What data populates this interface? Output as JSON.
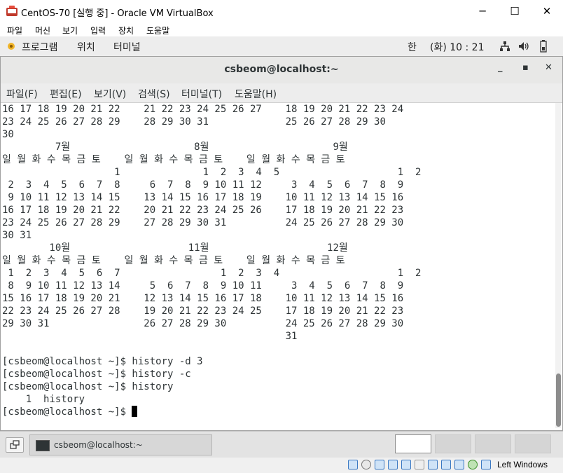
{
  "vbox": {
    "title": "CentOS-70 [실행 중] - Oracle VM VirtualBox",
    "minimize": "─",
    "maximize": "☐",
    "close": "✕",
    "menu": [
      "파일",
      "머신",
      "보기",
      "입력",
      "장치",
      "도움말"
    ]
  },
  "gnome": {
    "apps": "프로그램",
    "places": "위치",
    "terminal": "터미널",
    "input_method": "한",
    "clock": "(화) 10 : 21",
    "network_icon": "network-icon",
    "volume_icon": "volume-icon",
    "battery_icon": "battery-icon"
  },
  "terminal": {
    "title": "csbeom@localhost:~",
    "minimize": "_",
    "maximize": "▪",
    "close": "✕",
    "menu": [
      "파일(F)",
      "편집(E)",
      "보기(V)",
      "검색(S)",
      "터미널(T)",
      "도움말(H)"
    ],
    "lines": [
      "16 17 18 19 20 21 22    21 22 23 24 25 26 27    18 19 20 21 22 23 24",
      "23 24 25 26 27 28 29    28 29 30 31             25 26 27 28 29 30",
      "30",
      "         7월                     8월                     9월",
      "일 월 화 수 목 금 토    일 월 화 수 목 금 토    일 월 화 수 목 금 토",
      "                   1              1  2  3  4  5                    1  2",
      " 2  3  4  5  6  7  8     6  7  8  9 10 11 12     3  4  5  6  7  8  9",
      " 9 10 11 12 13 14 15    13 14 15 16 17 18 19    10 11 12 13 14 15 16",
      "16 17 18 19 20 21 22    20 21 22 23 24 25 26    17 18 19 20 21 22 23",
      "23 24 25 26 27 28 29    27 28 29 30 31          24 25 26 27 28 29 30",
      "30 31",
      "        10월                    11월                    12월",
      "일 월 화 수 목 금 토    일 월 화 수 목 금 토    일 월 화 수 목 금 토",
      " 1  2  3  4  5  6  7                 1  2  3  4                    1  2",
      " 8  9 10 11 12 13 14     5  6  7  8  9 10 11     3  4  5  6  7  8  9",
      "15 16 17 18 19 20 21    12 13 14 15 16 17 18    10 11 12 13 14 15 16",
      "22 23 24 25 26 27 28    19 20 21 22 23 24 25    17 18 19 20 21 22 23",
      "29 30 31                26 27 28 29 30          24 25 26 27 28 29 30",
      "                                                31",
      "",
      "[csbeom@localhost ~]$ history -d 3",
      "[csbeom@localhost ~]$ history -c",
      "[csbeom@localhost ~]$ history",
      "    1  history"
    ],
    "prompt": "[csbeom@localhost ~]$ "
  },
  "taskbar": {
    "task_label": "csbeom@localhost:~",
    "workspaces": 4
  },
  "statusbar": {
    "host_key": "Left Windows"
  },
  "colors": {
    "terminal_text": "#2e3436",
    "panel_bg": "#ededed",
    "taskbar_bg": "#e3e3e3"
  }
}
